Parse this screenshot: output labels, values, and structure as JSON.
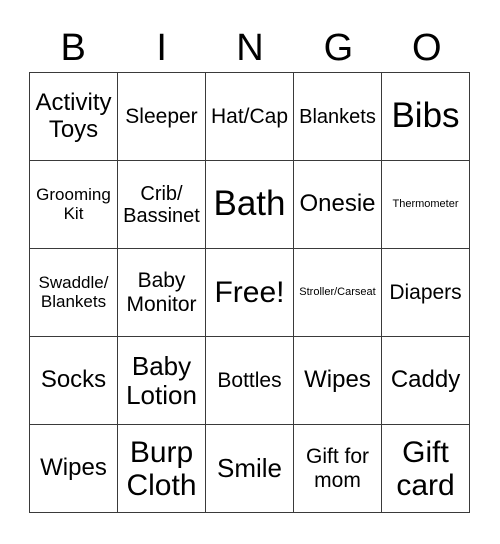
{
  "header": {
    "letters": [
      "B",
      "I",
      "N",
      "G",
      "O"
    ]
  },
  "grid": {
    "rows": [
      [
        "Activity\nToys",
        "Sleeper",
        "Hat/Cap",
        "Blankets",
        "Bibs"
      ],
      [
        "Grooming\nKit",
        "Crib/\nBassinet",
        "Bath",
        "Onesie",
        "Thermometer"
      ],
      [
        "Swaddle/\nBlankets",
        "Baby\nMonitor",
        "Free!",
        "Stroller/Carseat",
        "Diapers"
      ],
      [
        "Socks",
        "Baby\nLotion",
        "Bottles",
        "Wipes",
        "Caddy"
      ],
      [
        "Wipes",
        "Burp\nCloth",
        "Smile",
        "Gift for\nmom",
        "Gift\ncard"
      ]
    ],
    "free_space": "Free!"
  }
}
